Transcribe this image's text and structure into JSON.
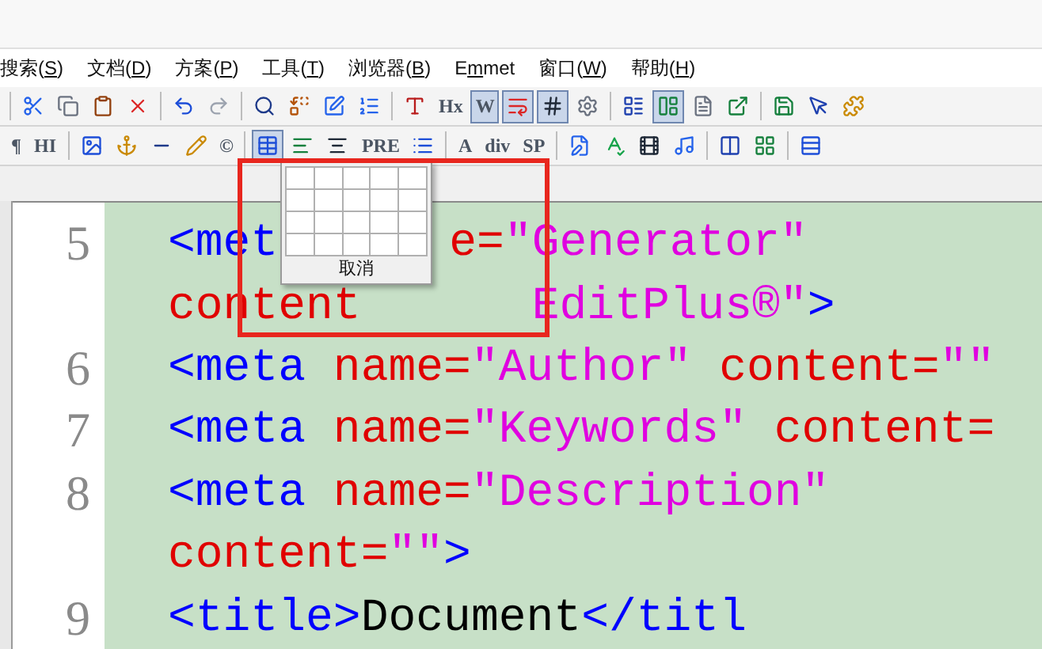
{
  "menu": [
    {
      "text": "搜索(",
      "key": "S",
      "tail": ")"
    },
    {
      "text": "文档(",
      "key": "D",
      "tail": ")"
    },
    {
      "text": "方案(",
      "key": "P",
      "tail": ")"
    },
    {
      "text": "工具(",
      "key": "T",
      "tail": ")"
    },
    {
      "text": "浏览器(",
      "key": "B",
      "tail": ")"
    },
    {
      "text": "E",
      "key": "m",
      "tail": "met"
    },
    {
      "text": "窗口(",
      "key": "W",
      "tail": ")"
    },
    {
      "text": "帮助(",
      "key": "H",
      "tail": ")"
    }
  ],
  "toolbar_1": [
    {
      "kind": "icon",
      "pressed": false
    },
    {
      "kind": "icon",
      "pressed": false
    },
    {
      "kind": "icon",
      "pressed": false
    },
    {
      "kind": "icon",
      "pressed": false
    },
    {
      "kind": "icon",
      "pressed": false
    },
    {
      "kind": "icon",
      "pressed": false
    },
    {
      "kind": "icon",
      "pressed": false
    },
    {
      "kind": "icon",
      "pressed": false
    },
    {
      "kind": "icon",
      "pressed": false
    },
    {
      "kind": "icon",
      "pressed": false
    },
    {
      "kind": "icon",
      "pressed": false
    },
    {
      "kind": "text",
      "text": "Hx",
      "pressed": false
    },
    {
      "kind": "text",
      "text": "W",
      "pressed": true
    },
    {
      "kind": "icon",
      "pressed": true
    },
    {
      "kind": "icon",
      "pressed": true
    },
    {
      "kind": "icon",
      "pressed": false
    },
    {
      "kind": "icon",
      "pressed": false
    },
    {
      "kind": "icon",
      "pressed": true
    },
    {
      "kind": "icon",
      "pressed": false
    },
    {
      "kind": "icon",
      "pressed": false
    },
    {
      "kind": "icon",
      "pressed": false
    },
    {
      "kind": "icon",
      "pressed": false
    },
    {
      "kind": "icon",
      "pressed": false
    }
  ],
  "toolbar_2": [
    {
      "kind": "text",
      "text": "¶",
      "pressed": false
    },
    {
      "kind": "text",
      "text": "HI",
      "pressed": false
    },
    {
      "kind": "icon",
      "pressed": false
    },
    {
      "kind": "icon",
      "pressed": false
    },
    {
      "kind": "icon",
      "pressed": false
    },
    {
      "kind": "icon",
      "pressed": false
    },
    {
      "kind": "text",
      "text": "©",
      "pressed": false
    },
    {
      "kind": "icon",
      "pressed": true
    },
    {
      "kind": "icon",
      "pressed": false
    },
    {
      "kind": "icon",
      "pressed": false
    },
    {
      "kind": "text",
      "text": "PRE",
      "pressed": false
    },
    {
      "kind": "icon",
      "pressed": false
    },
    {
      "kind": "text",
      "text": "A",
      "pressed": false
    },
    {
      "kind": "text",
      "text": "div",
      "pressed": false
    },
    {
      "kind": "text",
      "text": "SP",
      "pressed": false
    },
    {
      "kind": "icon",
      "pressed": false
    },
    {
      "kind": "icon",
      "pressed": false
    },
    {
      "kind": "icon",
      "pressed": false
    },
    {
      "kind": "icon",
      "pressed": false
    },
    {
      "kind": "icon",
      "pressed": false
    },
    {
      "kind": "icon",
      "pressed": false
    },
    {
      "kind": "icon",
      "pressed": false
    }
  ],
  "table_popup": {
    "cancel": "取消"
  },
  "editor": {
    "lines": [
      {
        "number": "5",
        "segments": [
          {
            "text": "<met",
            "kind": "tag"
          },
          {
            "text": "e=",
            "kind": "attr"
          },
          {
            "text": "\"Generator\"",
            "kind": "value"
          }
        ]
      },
      {
        "segments": [
          {
            "text": "content",
            "kind": "attr"
          },
          {
            "text": "EditPlus®\"",
            "kind": "value"
          },
          {
            "text": ">",
            "kind": "tag"
          }
        ]
      },
      {
        "number": "6",
        "segments": [
          {
            "text": "<meta ",
            "kind": "tag"
          },
          {
            "text": "name=",
            "kind": "attr"
          },
          {
            "text": "\"Author\" ",
            "kind": "value"
          },
          {
            "text": "content=",
            "kind": "attr"
          },
          {
            "text": "\"\"",
            "kind": "value"
          }
        ]
      },
      {
        "number": "7",
        "segments": [
          {
            "text": "<meta ",
            "kind": "tag"
          },
          {
            "text": "name=",
            "kind": "attr"
          },
          {
            "text": "\"Keywords\" ",
            "kind": "value"
          },
          {
            "text": "content=",
            "kind": "attr"
          }
        ]
      },
      {
        "number": "8",
        "segments": [
          {
            "text": "<meta ",
            "kind": "tag"
          },
          {
            "text": "name=",
            "kind": "attr"
          },
          {
            "text": "\"Description\"",
            "kind": "value"
          }
        ]
      },
      {
        "segments": [
          {
            "text": "content=",
            "kind": "attr"
          },
          {
            "text": "\"\"",
            "kind": "value"
          },
          {
            "text": ">",
            "kind": "tag"
          }
        ]
      },
      {
        "number": "9",
        "segments": [
          {
            "text": "<title>",
            "kind": "tag"
          },
          {
            "text": "Document",
            "kind": "plain"
          },
          {
            "text": "</titl",
            "kind": "tag"
          }
        ]
      }
    ]
  }
}
